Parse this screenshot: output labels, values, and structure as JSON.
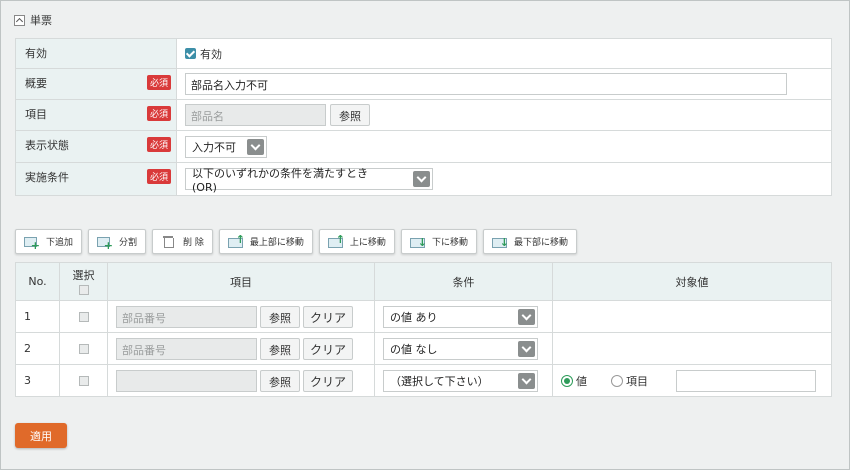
{
  "section": {
    "title": "単票"
  },
  "form": {
    "rows": [
      {
        "label": "有効",
        "required": false,
        "checkbox_label": "有効"
      },
      {
        "label": "概要",
        "required": true,
        "value": "部品名入力不可"
      },
      {
        "label": "項目",
        "required": true,
        "field_value": "部品名",
        "ref_button": "参照"
      },
      {
        "label": "表示状態",
        "required": true,
        "select_value": "入力不可"
      },
      {
        "label": "実施条件",
        "required": true,
        "select_value": "以下のいずれかの条件を満たすとき　(OR)"
      }
    ],
    "required_badge": "必須"
  },
  "toolbar": {
    "buttons": [
      "下追加",
      "分割",
      "削 除",
      "最上部に移動",
      "上に移動",
      "下に移動",
      "最下部に移動"
    ]
  },
  "table": {
    "headers": {
      "no": "No.",
      "select": "選択",
      "item": "項目",
      "condition": "条件",
      "target": "対象値"
    },
    "rows": [
      {
        "no": "1",
        "item_placeholder": "部品番号",
        "condition": "の値 あり"
      },
      {
        "no": "2",
        "item_placeholder": "部品番号",
        "condition": "の値 なし"
      },
      {
        "no": "3",
        "item_placeholder": "",
        "condition": "（選択して下さい）",
        "radio_value": "値",
        "radio_item": "項目"
      }
    ],
    "ref_button": "参照",
    "clear_button": "クリア"
  },
  "apply_button": "適用",
  "colors": {
    "accent": "#e06a2a",
    "required": "#d93a3a",
    "label_bg": "#eaf2f2",
    "check": "#3d8fa8"
  }
}
